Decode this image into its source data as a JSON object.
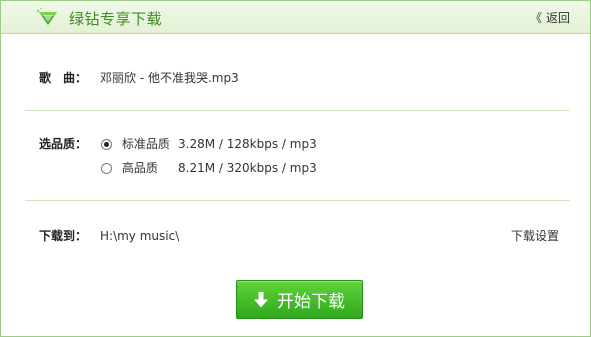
{
  "window": {
    "title": "绿钻专享下载",
    "back_label": "返回",
    "accent": "#3f8b23"
  },
  "song": {
    "label": "歌　曲：",
    "value": "邓丽欣 - 他不准我哭.mp3"
  },
  "quality": {
    "label": "选品质：",
    "options": [
      {
        "name": "标准品质",
        "detail": "3.28M / 128kbps / mp3",
        "selected": true
      },
      {
        "name": "高品质",
        "detail": "8.21M / 320kbps / mp3",
        "selected": false
      }
    ]
  },
  "download_to": {
    "label": "下载到：",
    "path": "H:\\my music\\",
    "settings_label": "下载设置"
  },
  "start_button": {
    "label": "开始下载",
    "color": "#3cb826"
  }
}
